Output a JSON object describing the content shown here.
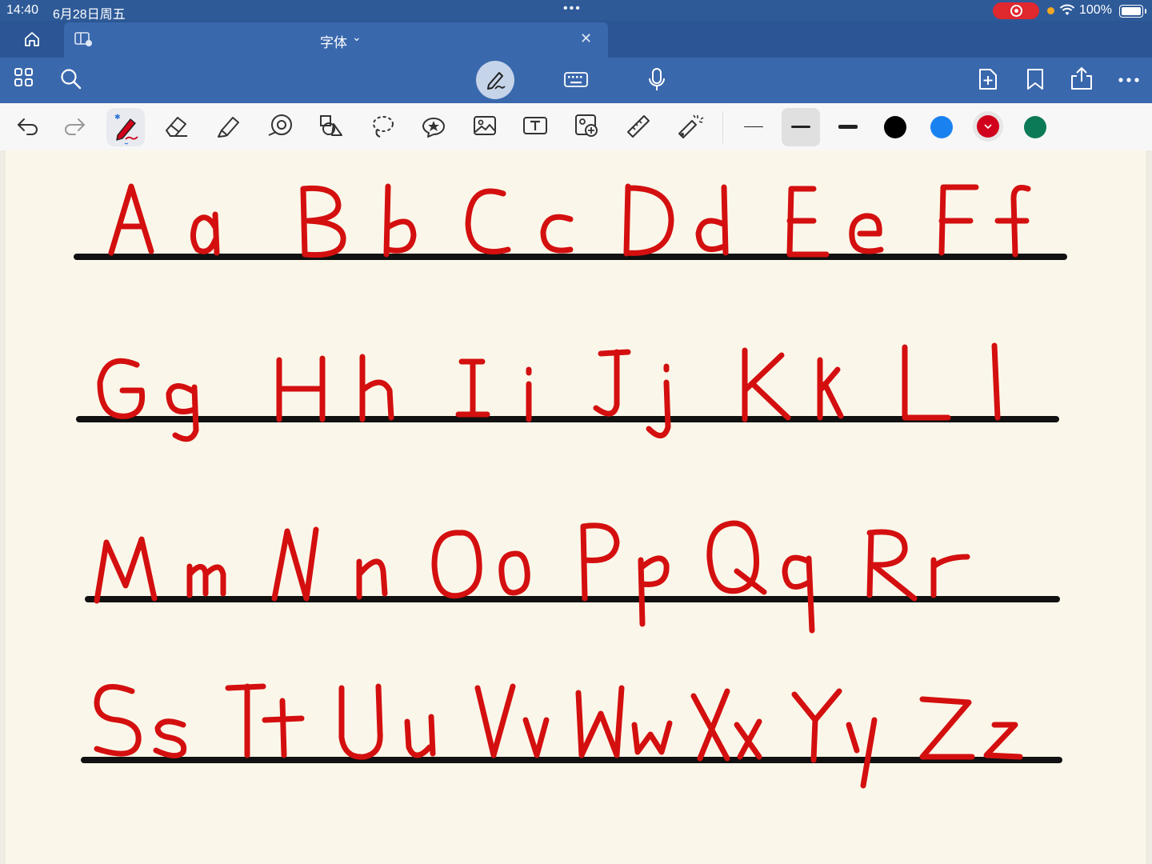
{
  "status_bar": {
    "time": "14:40",
    "date": "6月28日周五",
    "dots": "•••",
    "battery": "100%"
  },
  "tab": {
    "title": "字体",
    "chevron": "⌄",
    "close": "✕"
  },
  "toolbar": {
    "icons": [
      "grid-icon",
      "search-icon",
      "pen-mode-icon",
      "keyboard-icon",
      "microphone-icon",
      "add-page-icon",
      "bookmark-icon",
      "share-icon",
      "more-icon"
    ]
  },
  "drawing_tools": {
    "tools": [
      "undo-icon",
      "redo-icon",
      "pen-icon",
      "eraser-icon",
      "highlighter-icon",
      "shape-tool-icon",
      "element-icon",
      "lasso-icon",
      "sticker-icon",
      "image-icon",
      "textbox-icon",
      "camera-icon",
      "ruler-icon",
      "laser-pointer-icon"
    ],
    "colors": [
      "#000000",
      "#1a82f0",
      "#d0021b",
      "#0c7a56"
    ],
    "selected_color": "#d0021b",
    "stroke_widths": [
      "thin",
      "medium",
      "thick"
    ],
    "selected_stroke": "medium"
  },
  "canvas": {
    "ink_color": "#d40f0f",
    "rule_color": "#111111",
    "rows": [
      "Aa Bb Cc Dd Ee Ff",
      "Gg Hh Ii Jj Kk Ll",
      "Mm Nn Oo Pp Qq Rr",
      "Ss Tt Uu Vv Ww Xx Yy Zz"
    ]
  }
}
